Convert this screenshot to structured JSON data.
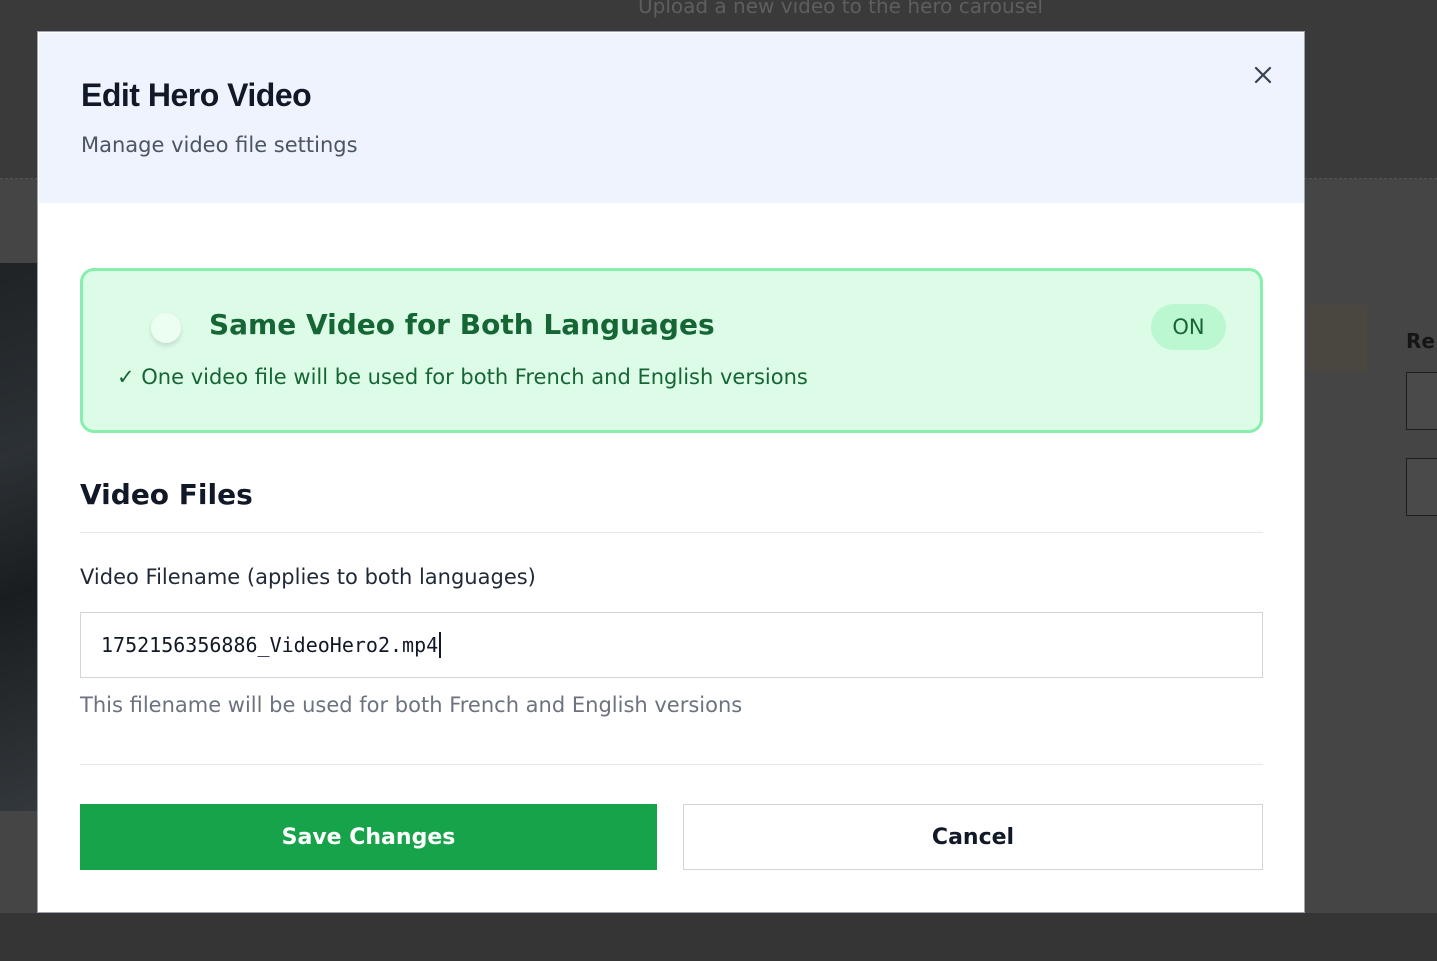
{
  "background": {
    "subtitle": "Upload a new video to the hero carousel",
    "right_label": "Re"
  },
  "modal": {
    "title": "Edit Hero Video",
    "subtitle": "Manage video file settings",
    "close_icon": "close-icon",
    "same_video": {
      "title": "Same Video for Both Languages",
      "status": "ON",
      "note": "✓ One video file will be used for both French and English versions",
      "enabled": true
    },
    "video_files": {
      "section_title": "Video Files",
      "field_label": "Video Filename (applies to both languages)",
      "filename_value": "1752156356886_VideoHero2.mp4",
      "help_text": "This filename will be used for both French and English versions"
    },
    "buttons": {
      "save_label": "Save Changes",
      "cancel_label": "Cancel"
    }
  },
  "colors": {
    "primary_green": "#16a34a",
    "card_background": "#dcfce7",
    "card_border": "#86efac",
    "header_background": "#eef3fe"
  }
}
